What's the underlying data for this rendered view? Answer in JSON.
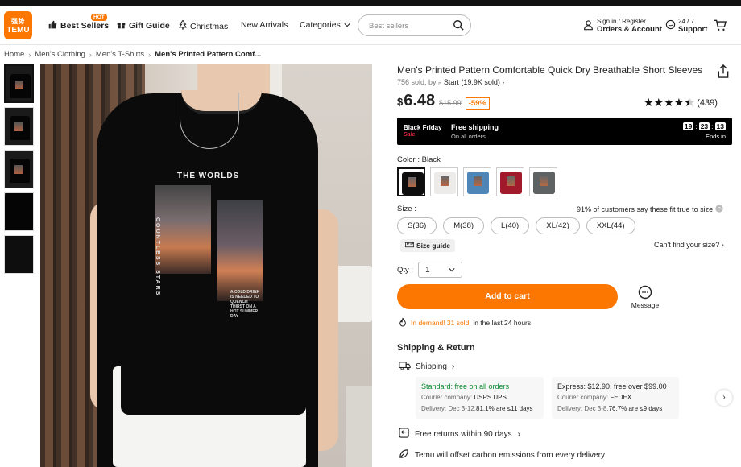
{
  "logo": {
    "line1": "强势",
    "line2": "TEMU"
  },
  "nav": {
    "best_sellers": "Best Sellers",
    "hot_badge": "HOT",
    "gift_guide": "Gift Guide",
    "christmas": "Christmas",
    "new_arrivals": "New Arrivals",
    "categories": "Categories"
  },
  "search": {
    "placeholder": "Best sellers"
  },
  "account": {
    "line1": "Sign in / Register",
    "line2": "Orders & Account"
  },
  "support": {
    "line1": "24 / 7",
    "line2": "Support"
  },
  "breadcrumb": [
    "Home",
    "Men's Clothing",
    "Men's T-Shirts",
    "Men's Printed Pattern Comf..."
  ],
  "hero_print": {
    "title": "THE WORLDS",
    "vertical": "COUNTLESS STARS",
    "small": "A COLD DRINK IS NEEDED TO QUENCH THIRST ON A HOT SUMMER DAY"
  },
  "product": {
    "title": "Men's Printed Pattern Comfortable Quick Dry Breathable Short Sleeves",
    "sold": "756 sold, by",
    "store": "Start (19.9K sold)",
    "currency": "$",
    "price": "6.48",
    "orig_price": "$15.99",
    "discount": "-59%",
    "rating": 4.5,
    "reviews": "(439)"
  },
  "promo": {
    "event_line1": "Black Friday",
    "event_line2": "Sale",
    "shipping_title": "Free shipping",
    "shipping_sub": "On all orders",
    "timer_h": "19",
    "timer_m": "23",
    "timer_s": "13",
    "ends": "Ends in"
  },
  "color": {
    "label": "Color : Black",
    "swatches": [
      {
        "name": "Black",
        "color": "#0d0d0d"
      },
      {
        "name": "White",
        "color": "#ecebea"
      },
      {
        "name": "Blue",
        "color": "#4e86b8"
      },
      {
        "name": "Red",
        "color": "#a11a2c"
      },
      {
        "name": "Gray",
        "color": "#5f6262"
      }
    ]
  },
  "size": {
    "label": "Size :",
    "fit_note": "91% of customers say these fit true to size",
    "options": [
      "S(36)",
      "M(38)",
      "L(40)",
      "XL(42)",
      "XXL(44)"
    ],
    "guide": "Size guide",
    "cant_find": "Can't find your size?"
  },
  "qty": {
    "label": "Qty :",
    "value": "1"
  },
  "add_to_cart": "Add to cart",
  "message": "Message",
  "demand": {
    "highlight": "In demand! 31 sold",
    "rest": "in the last 24 hours"
  },
  "shipping": {
    "heading": "Shipping & Return",
    "label": "Shipping",
    "standard": {
      "title": "Standard: free on all orders",
      "courier_label": "Courier company:",
      "couriers": "USPS  UPS",
      "delivery_prefix": "Delivery: Dec 3-12,",
      "delivery_bold": "81.1% are ≤11 days"
    },
    "express": {
      "title": "Express: $12.90, free over $99.00",
      "courier_label": "Courier company:",
      "couriers": "FEDEX",
      "delivery_prefix": "Delivery: Dec 3-8,",
      "delivery_bold": "76.7% are ≤9 days"
    },
    "returns": "Free returns within 90 days",
    "carbon": "Temu will offset carbon emissions from every delivery"
  },
  "colors": {
    "accent": "#fb7701",
    "success": "#0a8a2b"
  }
}
